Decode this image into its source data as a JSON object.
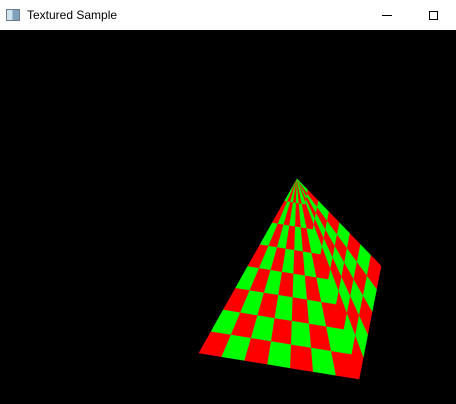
{
  "window": {
    "title": "Textured Sample",
    "icon": "application-window-icon"
  },
  "controls": {
    "minimize_icon": "minimize-icon",
    "maximize_icon": "maximize-icon"
  },
  "scene": {
    "background": "#000000",
    "object": "checkerboard-textured-pyramid",
    "texture_colors": [
      "#ff0000",
      "#00ff00"
    ],
    "faces": [
      {
        "name": "front-face",
        "columns": 7,
        "rows": 8
      },
      {
        "name": "right-face",
        "columns": 5,
        "rows": 8
      }
    ]
  }
}
